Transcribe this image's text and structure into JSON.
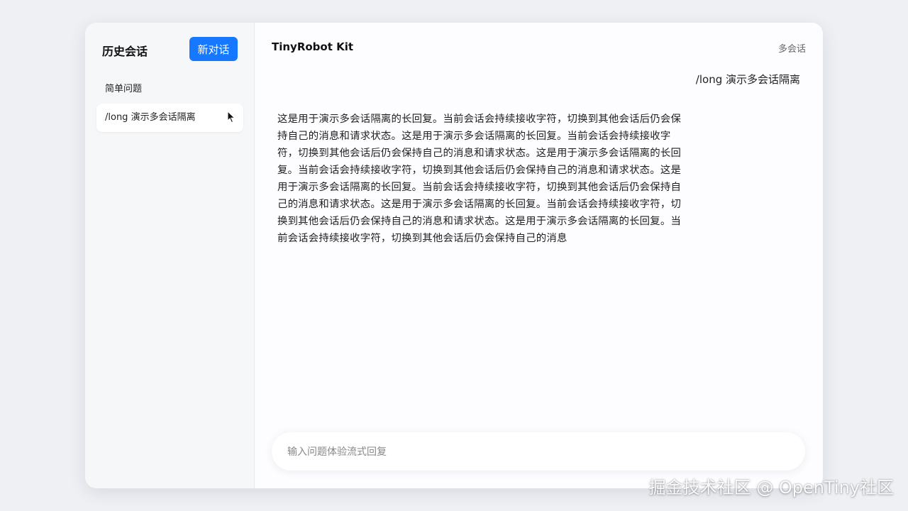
{
  "sidebar": {
    "title": "历史会话",
    "new_chat_label": "新对话",
    "sessions": [
      {
        "label": "简单问题"
      },
      {
        "label": "/long 演示多会话隔离"
      }
    ]
  },
  "header": {
    "title": "TinyRobot Kit",
    "tag": "多会话"
  },
  "conversation": {
    "user_message": "/long 演示多会话隔离",
    "assistant_message": "这是用于演示多会话隔离的长回复。当前会话会持续接收字符，切换到其他会话后仍会保持自己的消息和请求状态。这是用于演示多会话隔离的长回复。当前会话会持续接收字符，切换到其他会话后仍会保持自己的消息和请求状态。这是用于演示多会话隔离的长回复。当前会话会持续接收字符，切换到其他会话后仍会保持自己的消息和请求状态。这是用于演示多会话隔离的长回复。当前会话会持续接收字符，切换到其他会话后仍会保持自己的消息和请求状态。这是用于演示多会话隔离的长回复。当前会话会持续接收字符，切换到其他会话后仍会保持自己的消息和请求状态。这是用于演示多会话隔离的长回复。当前会话会持续接收字符，切换到其他会话后仍会保持自己的消息"
  },
  "input": {
    "placeholder": "输入问题体验流式回复",
    "value": ""
  },
  "watermark": "掘金技术社区 @ OpenTiny社区",
  "colors": {
    "accent": "#1677ff",
    "background": "#eef0f4"
  },
  "icons": {
    "cursor": "mouse-pointer-icon"
  }
}
